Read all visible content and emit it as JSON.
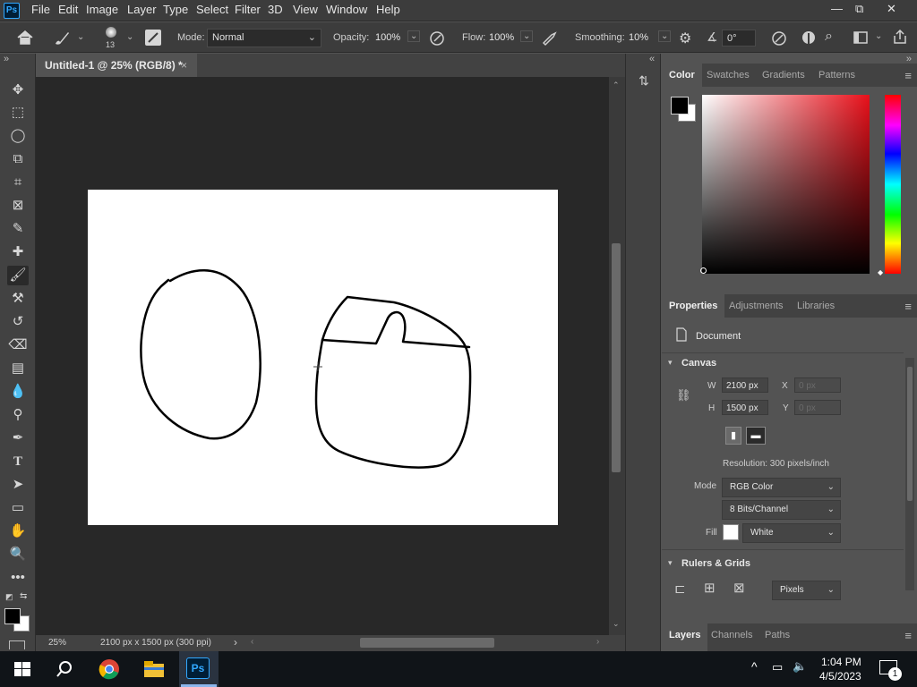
{
  "app": {
    "logo": "Ps"
  },
  "menu": [
    "File",
    "Edit",
    "Image",
    "Layer",
    "Type",
    "Select",
    "Filter",
    "3D",
    "View",
    "Window",
    "Help"
  ],
  "window_controls": {
    "minimize": "—",
    "restore": "⧉",
    "close": "✕"
  },
  "options": {
    "brush_size": "13",
    "mode_label": "Mode:",
    "mode_value": "Normal",
    "opacity_label": "Opacity:",
    "opacity_value": "100%",
    "flow_label": "Flow:",
    "flow_value": "100%",
    "smoothing_label": "Smoothing:",
    "smoothing_value": "10%",
    "angle_value": "0°"
  },
  "collapse_left": "»",
  "collapse_right": "«",
  "document": {
    "tab_title": "Untitled-1 @ 25% (RGB/8) *",
    "close": "×"
  },
  "status": {
    "zoom": "25%",
    "info": "2100 px x 1500 px (300 ppi)",
    "arrow": "›"
  },
  "color_panel": {
    "tabs": [
      "Color",
      "Swatches",
      "Gradients",
      "Patterns"
    ],
    "active": 0,
    "foreground": "#000000",
    "background": "#ffffff"
  },
  "properties_panel": {
    "tabs": [
      "Properties",
      "Adjustments",
      "Libraries"
    ],
    "active": 0,
    "kind": "Document",
    "canvas_section": "Canvas",
    "w_label": "W",
    "w_value": "2100 px",
    "h_label": "H",
    "h_value": "1500 px",
    "x_label": "X",
    "x_value": "0 px",
    "y_label": "Y",
    "y_value": "0 px",
    "resolution": "Resolution: 300 pixels/inch",
    "mode_label": "Mode",
    "mode_value": "RGB Color",
    "bits_value": "8 Bits/Channel",
    "fill_label": "Fill",
    "fill_value": "White",
    "rulers_section": "Rulers & Grids",
    "units_value": "Pixels"
  },
  "layers_panel": {
    "tabs": [
      "Layers",
      "Channels",
      "Paths"
    ],
    "active": 0
  },
  "taskbar": {
    "time": "1:04 PM",
    "date": "4/5/2023",
    "notif_count": "1",
    "apps": [
      "start-icon",
      "search-icon",
      "chrome-icon",
      "file-explorer-icon",
      "photoshop-icon"
    ]
  },
  "colors": {
    "accent": "#31a8ff",
    "chrome": "#3c3c3c",
    "panel": "#535353"
  }
}
